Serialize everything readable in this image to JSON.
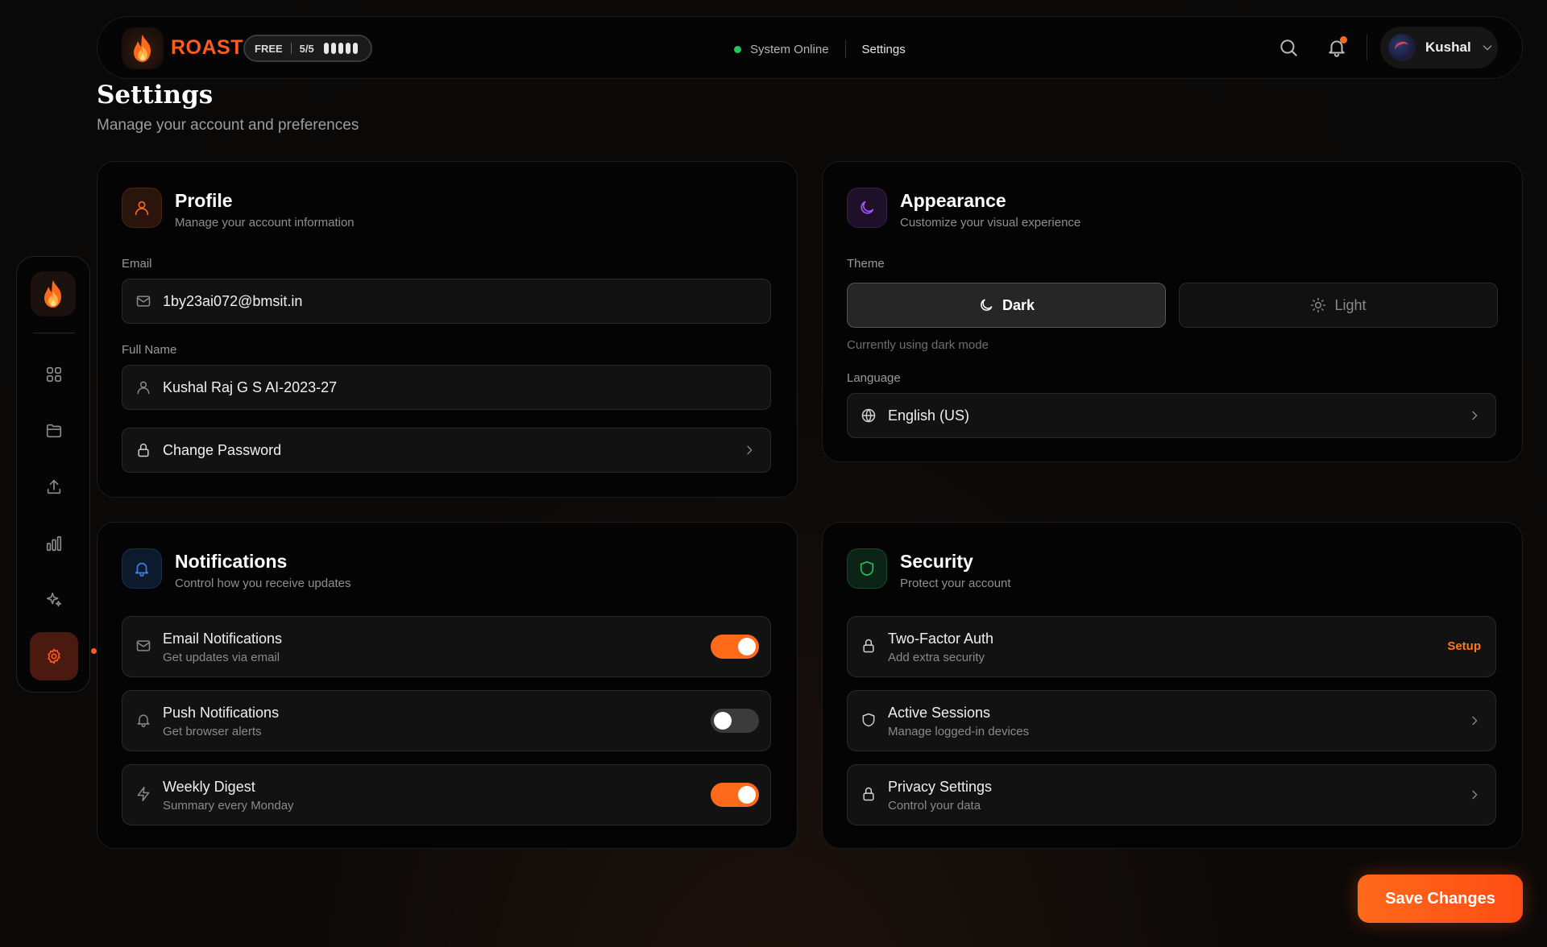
{
  "header": {
    "brand": "ROAST",
    "plan": "FREE",
    "credits": "5/5",
    "status": "System Online",
    "breadcrumb": "Settings",
    "user_name": "Kushal"
  },
  "page": {
    "title": "Settings",
    "subtitle": "Manage your account and preferences"
  },
  "profile": {
    "title": "Profile",
    "subtitle": "Manage your account information",
    "email_label": "Email",
    "email_value": "1by23ai072@bmsit.in",
    "name_label": "Full Name",
    "name_value": "Kushal Raj G S AI-2023-27",
    "change_password": "Change Password"
  },
  "appearance": {
    "title": "Appearance",
    "subtitle": "Customize your visual experience",
    "theme_label": "Theme",
    "theme_dark": "Dark",
    "theme_light": "Light",
    "theme_hint": "Currently using dark mode",
    "language_label": "Language",
    "language_value": "English (US)"
  },
  "notifications": {
    "title": "Notifications",
    "subtitle": "Control how you receive updates",
    "items": [
      {
        "title": "Email Notifications",
        "sub": "Get updates via email",
        "enabled": true
      },
      {
        "title": "Push Notifications",
        "sub": "Get browser alerts",
        "enabled": false
      },
      {
        "title": "Weekly Digest",
        "sub": "Summary every Monday",
        "enabled": true
      }
    ]
  },
  "security": {
    "title": "Security",
    "subtitle": "Protect your account",
    "items": [
      {
        "title": "Two-Factor Auth",
        "sub": "Add extra security",
        "action": "Setup"
      },
      {
        "title": "Active Sessions",
        "sub": "Manage logged-in devices"
      },
      {
        "title": "Privacy Settings",
        "sub": "Control your data"
      }
    ]
  },
  "actions": {
    "save": "Save Changes"
  },
  "colors": {
    "accent": "#ff5a1f",
    "status_online": "#22c55e",
    "profile_icon": "#ff6a1a",
    "appearance_icon": "#a855f7",
    "notifications_icon": "#3b82f6",
    "security_icon": "#22c55e"
  },
  "icons": {
    "brand": "flame-icon",
    "sidebar": [
      "grid-icon",
      "folder-icon",
      "upload-icon",
      "bar-chart-icon",
      "sparkles-icon",
      "gear-icon"
    ]
  }
}
